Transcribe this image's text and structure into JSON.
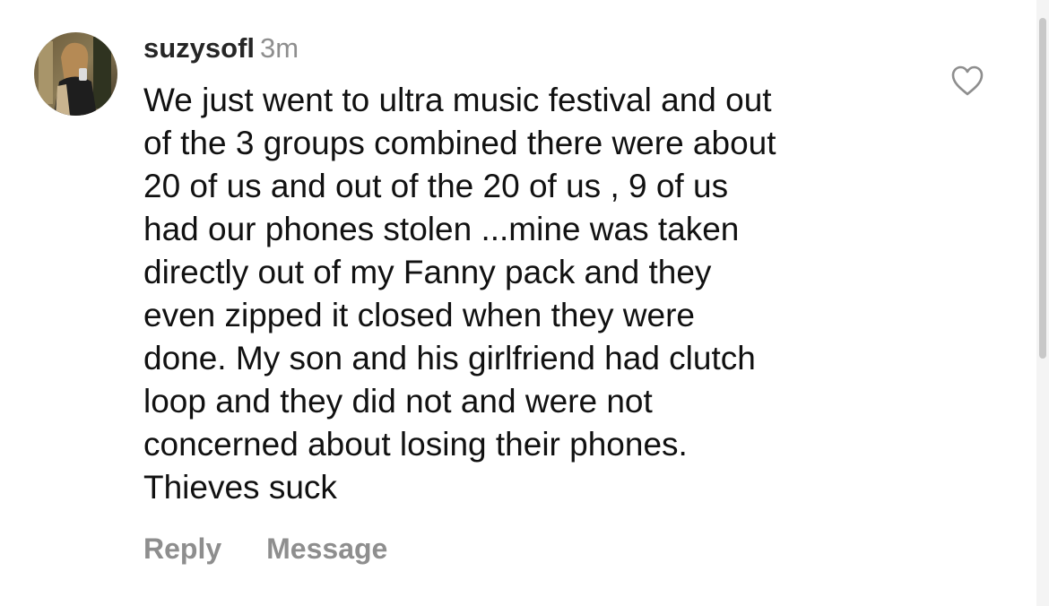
{
  "comment": {
    "username": "suzysofl",
    "timestamp": "3m",
    "avatar_icon": "profile-photo",
    "like_icon": "heart-outline-icon",
    "text_lines": [
      "We just went to ultra music festival and out",
      "of the 3 groups combined there were about",
      "20 of us and out of the 20 of us , 9 of us",
      "had our phones stolen ...mine was taken",
      "directly out of my Fanny pack and they",
      "even zipped it closed when they were",
      "done. My son and his girlfriend had clutch",
      "loop and they did not and were not",
      "concerned about losing their phones.",
      "Thieves suck"
    ],
    "actions": {
      "reply_label": "Reply",
      "message_label": "Message"
    }
  },
  "colors": {
    "username": "#262626",
    "secondary_text": "#8e8e8e",
    "body_text": "#111111",
    "background": "#ffffff"
  }
}
